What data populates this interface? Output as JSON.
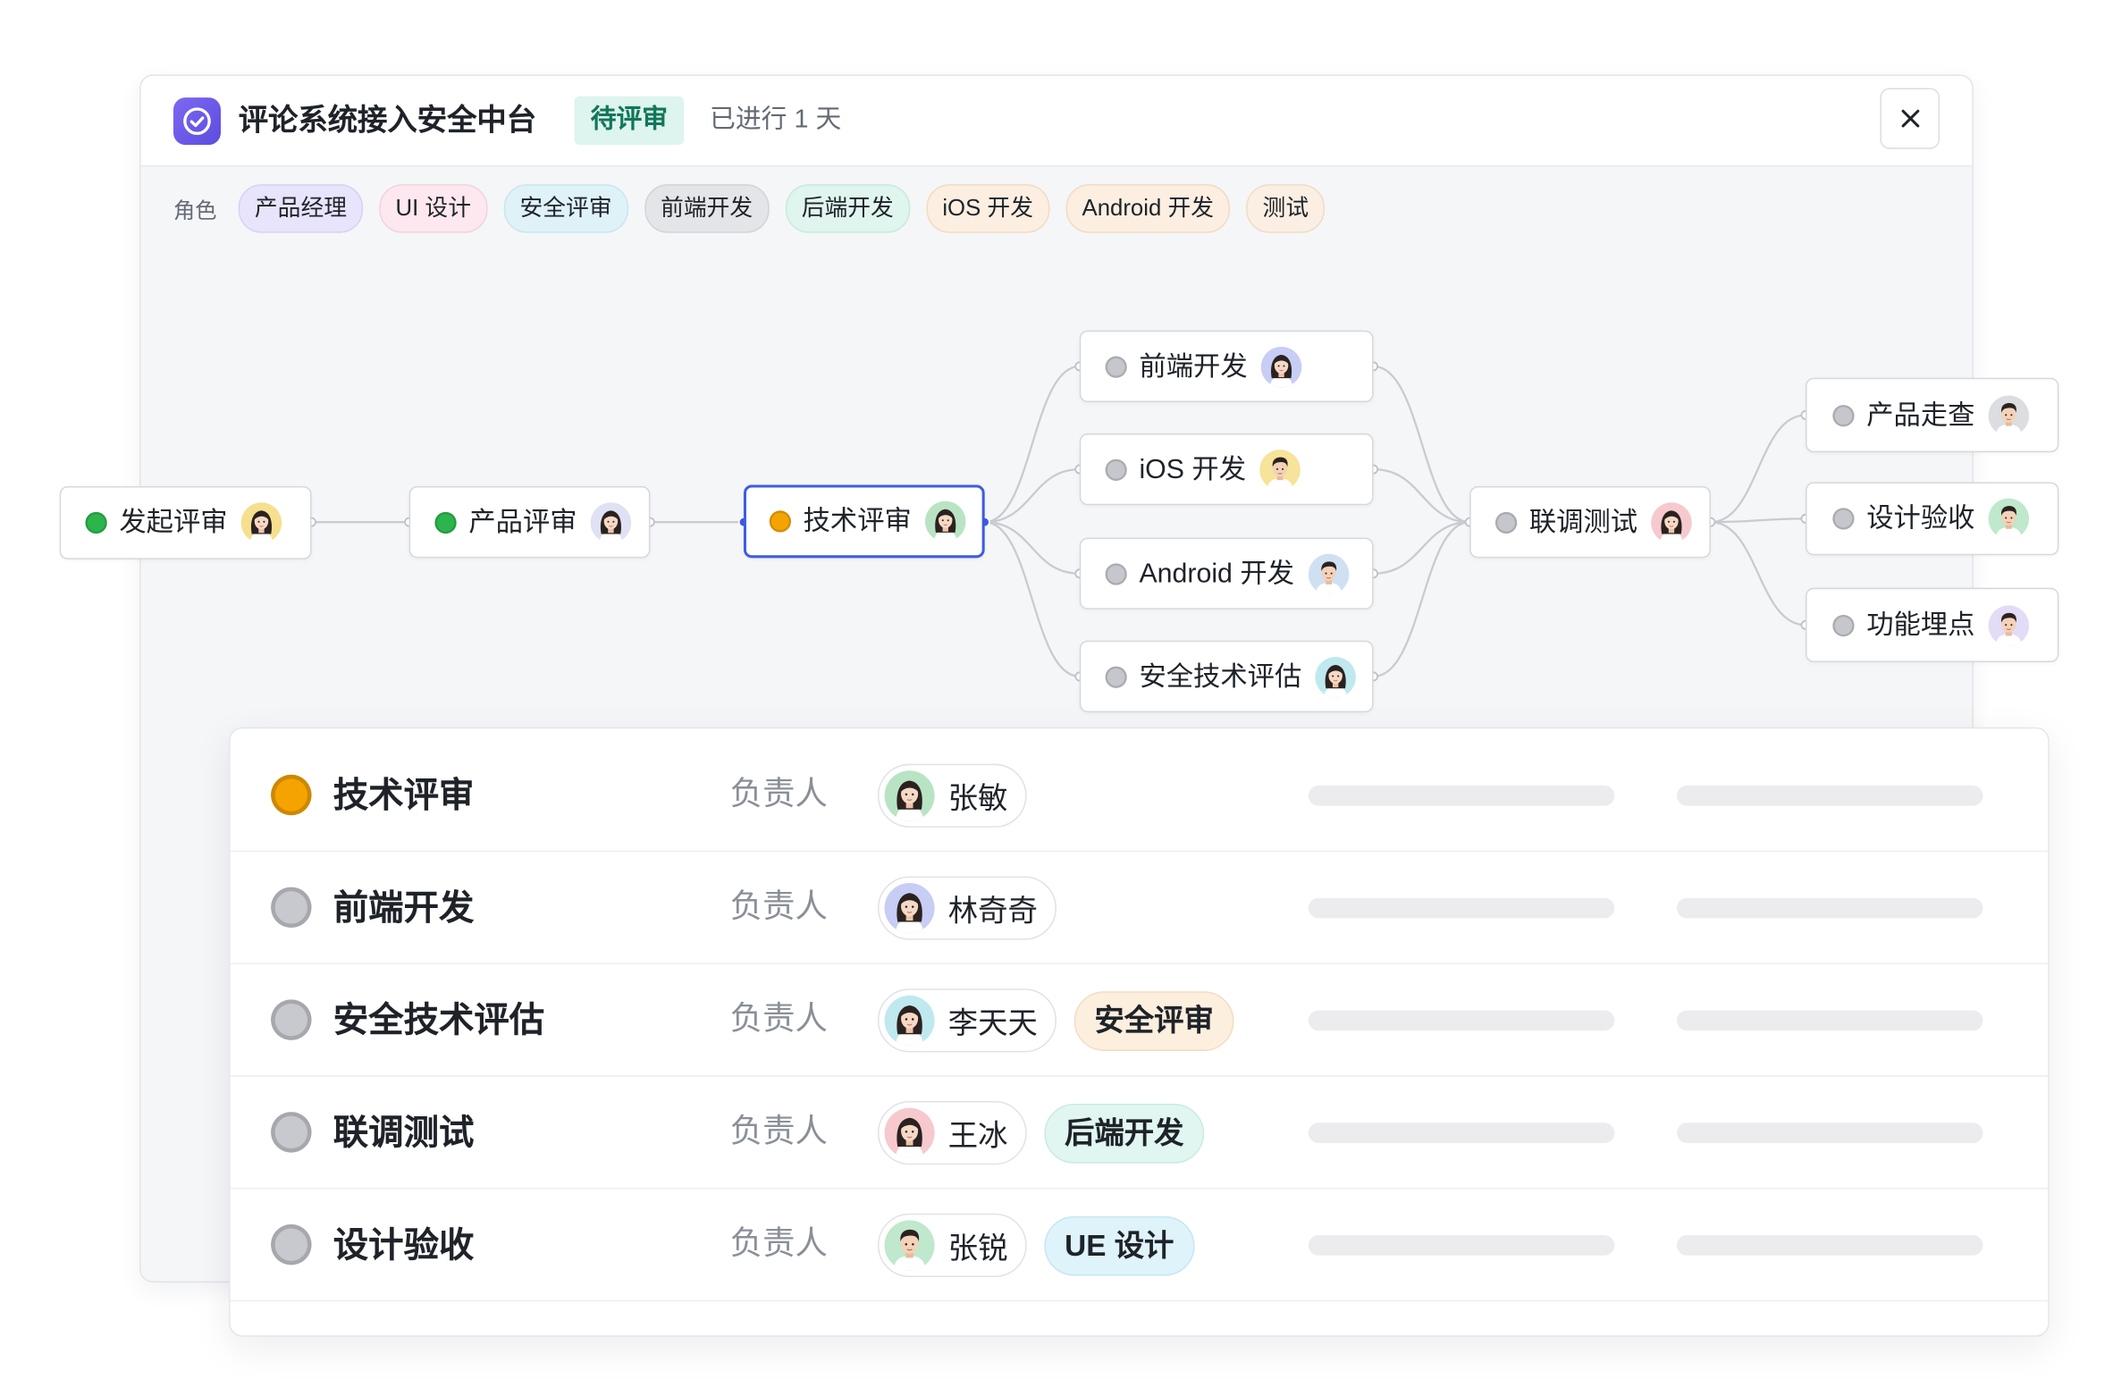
{
  "header": {
    "icon": "check-circle-icon",
    "title": "评论系统接入安全中台",
    "status_badge": "待评审",
    "badge_bg": "#def4ee",
    "badge_color": "#11775a",
    "elapsed": "已进行 1 天",
    "close_icon": "close-icon"
  },
  "roles": {
    "label": "角色",
    "items": [
      {
        "label": "产品经理",
        "bg": "#e7e4fb",
        "border": "#d6d1f5"
      },
      {
        "label": "UI 设计",
        "bg": "#fce8ee",
        "border": "#f4d2dd"
      },
      {
        "label": "安全评审",
        "bg": "#dff2f8",
        "border": "#c8e6f1"
      },
      {
        "label": "前端开发",
        "bg": "#e4e5e9",
        "border": "#d2d4d9"
      },
      {
        "label": "后端开发",
        "bg": "#dff5ee",
        "border": "#c7eadf"
      },
      {
        "label": "iOS 开发",
        "bg": "#fcefe1",
        "border": "#f2dbc2"
      },
      {
        "label": "Android 开发",
        "bg": "#fcefe1",
        "border": "#f2dbc2"
      },
      {
        "label": "测试",
        "bg": "#fbefe3",
        "border": "#f0dcc6"
      }
    ]
  },
  "flow": {
    "selected_color": "#3d5ce6",
    "nodes": [
      {
        "label": "发起评审",
        "dot": "#2bb54c"
      },
      {
        "label": "产品评审",
        "dot": "#2bb54c"
      },
      {
        "label": "技术评审",
        "dot": "#f5a300"
      },
      {
        "label": "前端开发",
        "dot": "#c5c7cc"
      },
      {
        "label": "iOS 开发",
        "dot": "#c5c7cc"
      },
      {
        "label": "Android 开发",
        "dot": "#c5c7cc"
      },
      {
        "label": "安全技术评估",
        "dot": "#c5c7cc"
      },
      {
        "label": "联调测试",
        "dot": "#c5c7cc"
      },
      {
        "label": "产品走查",
        "dot": "#c5c7cc"
      },
      {
        "label": "设计验收",
        "dot": "#c5c7cc"
      },
      {
        "label": "功能埋点",
        "dot": "#c5c7cc"
      }
    ]
  },
  "tasks": {
    "owner_label": "负责人",
    "rows": [
      {
        "title": "技术评审",
        "status_color": "#f5a300",
        "owner": "张敏"
      },
      {
        "title": "前端开发",
        "status_color": "#c7c9ce",
        "owner": "林奇奇"
      },
      {
        "title": "安全技术评估",
        "status_color": "#c7c9ce",
        "owner": "李天天",
        "tag": {
          "label": "安全评审",
          "bg": "#fdefde",
          "border": "#f3dcc2"
        }
      },
      {
        "title": "联调测试",
        "status_color": "#c7c9ce",
        "owner": "王冰",
        "tag": {
          "label": "后端开发",
          "bg": "#e1f6f1",
          "border": "#c9ebe2"
        }
      },
      {
        "title": "设计验收",
        "status_color": "#c7c9ce",
        "owner": "张锐",
        "tag": {
          "label": "UE 设计",
          "bg": "#dff3fb",
          "border": "#c5e6f3"
        }
      }
    ]
  }
}
